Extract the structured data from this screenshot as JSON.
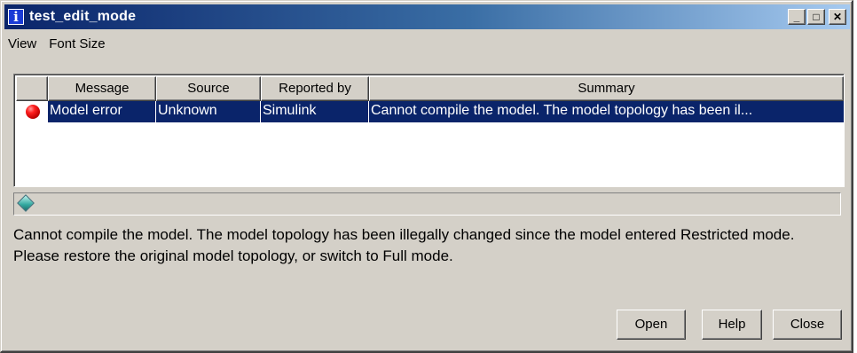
{
  "window": {
    "title": "test_edit_mode",
    "app_icon": "info-icon",
    "app_icon_glyph": "i",
    "controls": {
      "minimize": "_",
      "maximize": "□",
      "close": "✕"
    }
  },
  "menu": {
    "items": [
      "View",
      "Font Size"
    ]
  },
  "table": {
    "columns": [
      "",
      "Message",
      "Source",
      "Reported by",
      "Summary"
    ],
    "rows": [
      {
        "status_icon": "red-error-dot-icon",
        "message": "Model error",
        "source": "Unknown",
        "reported_by": "Simulink",
        "summary": "Cannot compile the model. The model topology has been il..."
      }
    ]
  },
  "detail": {
    "icon": "diamond-icon",
    "text": "Cannot compile the model. The model topology has been illegally changed since the model entered Restricted mode. Please restore the original model topology, or switch to Full mode."
  },
  "buttons": {
    "open": "Open",
    "help": "Help",
    "close": "Close"
  },
  "colors": {
    "selection": "#0a246a",
    "titlebar_start": "#0a246a",
    "titlebar_end": "#a6caf0",
    "window_bg": "#d4d0c8"
  }
}
